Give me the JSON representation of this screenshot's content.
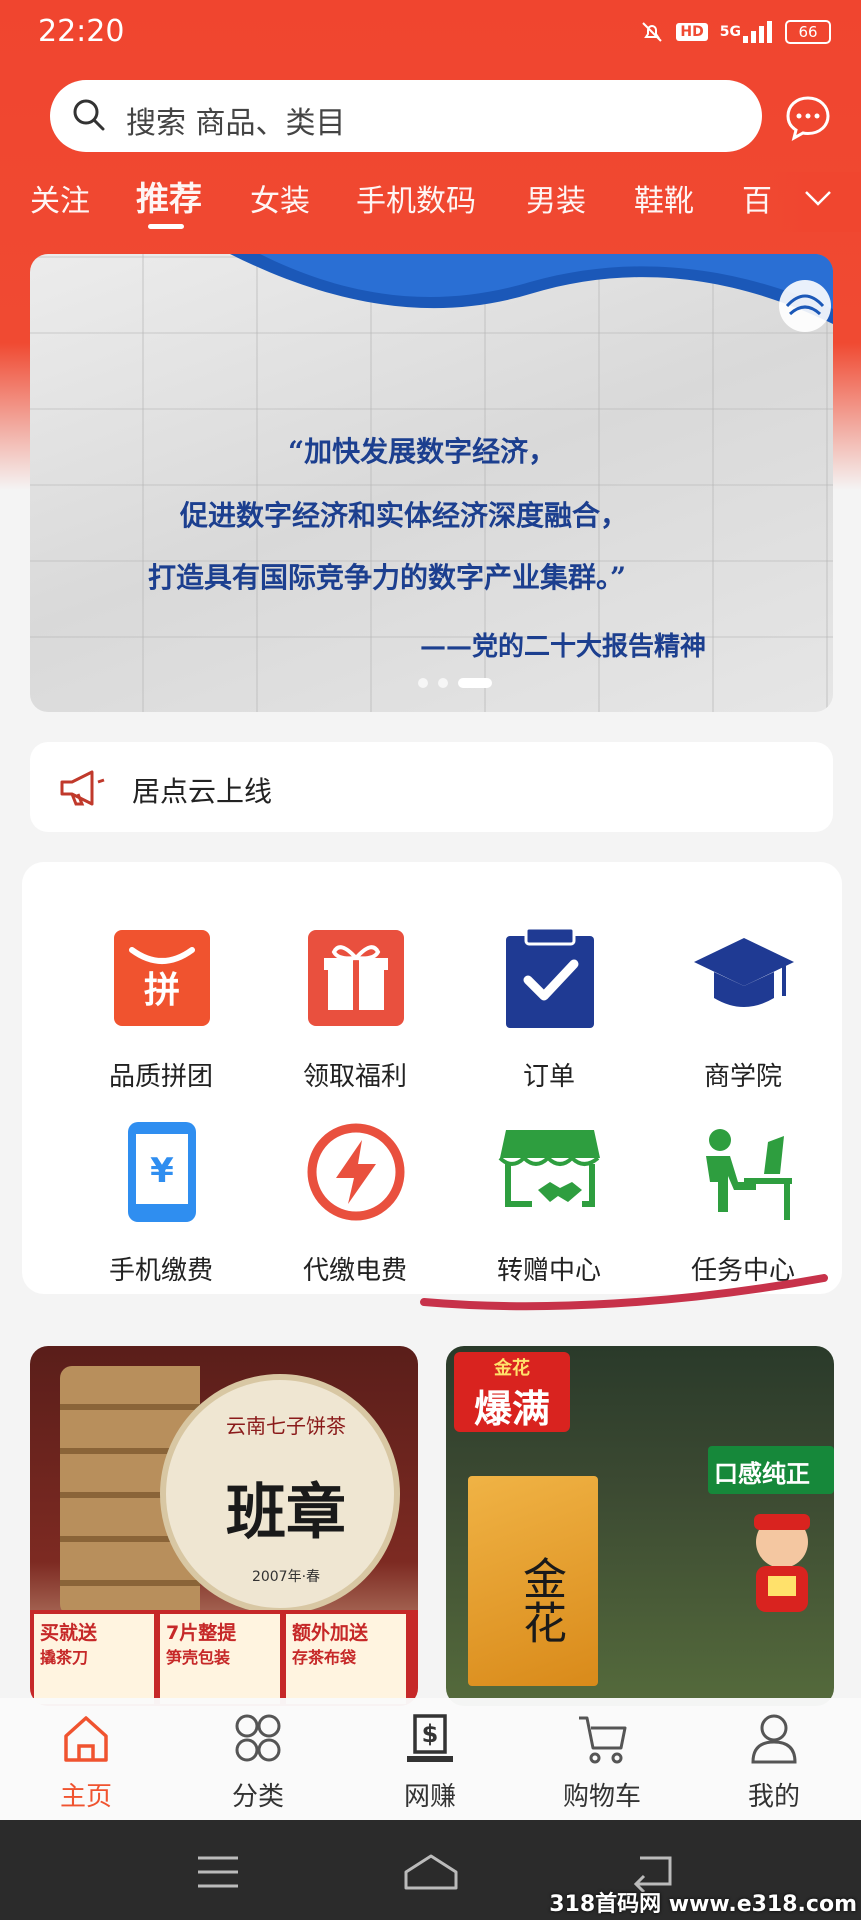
{
  "status_bar": {
    "time": "22:20",
    "network": "5G",
    "hd": "HD",
    "battery": "66"
  },
  "search": {
    "placeholder": "搜索 商品、类目"
  },
  "tabs": [
    {
      "label": "关注",
      "active": false
    },
    {
      "label": "推荐",
      "active": true
    },
    {
      "label": "女装",
      "active": false
    },
    {
      "label": "手机数码",
      "active": false
    },
    {
      "label": "男装",
      "active": false
    },
    {
      "label": "鞋靴",
      "active": false
    },
    {
      "label": "百",
      "active": false
    }
  ],
  "banner": {
    "lines": [
      "“加快发展数字经济，",
      "促进数字经济和实体经济深度融合，",
      "打造具有国际竞争力的数字产业集群。”",
      "——党的二十大报告精神"
    ],
    "slide_index": 3,
    "slide_count": 3
  },
  "notice": {
    "text": "居点云上线",
    "icon": "megaphone-icon"
  },
  "services": [
    {
      "label": "品质拼团",
      "icon": "group-buy-icon",
      "color": "#f0532f"
    },
    {
      "label": "领取福利",
      "icon": "gift-icon",
      "color": "#e9503e"
    },
    {
      "label": "订单",
      "icon": "clipboard-check-icon",
      "color": "#1f3a93"
    },
    {
      "label": "商学院",
      "icon": "graduation-cap-icon",
      "color": "#1f3a93"
    },
    {
      "label": "手机缴费",
      "icon": "phone-yuan-icon",
      "color": "#2f8ef0"
    },
    {
      "label": "代缴电费",
      "icon": "lightning-icon",
      "color": "#e9503e"
    },
    {
      "label": "转赠中心",
      "icon": "shop-handshake-icon",
      "color": "#2e9e3f"
    },
    {
      "label": "任务中心",
      "icon": "person-desk-icon",
      "color": "#2e9e3f"
    }
  ],
  "products": [
    {
      "title": "班章",
      "subtitle": "云南七子饼茶",
      "year": "2007年·春",
      "promos": [
        {
          "title": "买就送",
          "sub": "撬茶刀"
        },
        {
          "title": "7片整提",
          "sub": "笋壳包装"
        },
        {
          "title": "额外加送",
          "sub": "存茶布袋"
        }
      ]
    },
    {
      "badge_small": "金花",
      "badge_big": "爆满",
      "box_text": "金花",
      "tag": "口感纯正"
    }
  ],
  "bottom_nav": [
    {
      "label": "主页",
      "icon": "home-icon",
      "active": true
    },
    {
      "label": "分类",
      "icon": "category-icon",
      "active": false
    },
    {
      "label": "网赚",
      "icon": "money-icon",
      "active": false
    },
    {
      "label": "购物车",
      "icon": "cart-icon",
      "active": false
    },
    {
      "label": "我的",
      "icon": "user-icon",
      "active": false
    }
  ],
  "watermark": "318首码网 www.e318.com",
  "colors": {
    "brand": "#f0462f",
    "nav_active": "#f0532f"
  }
}
